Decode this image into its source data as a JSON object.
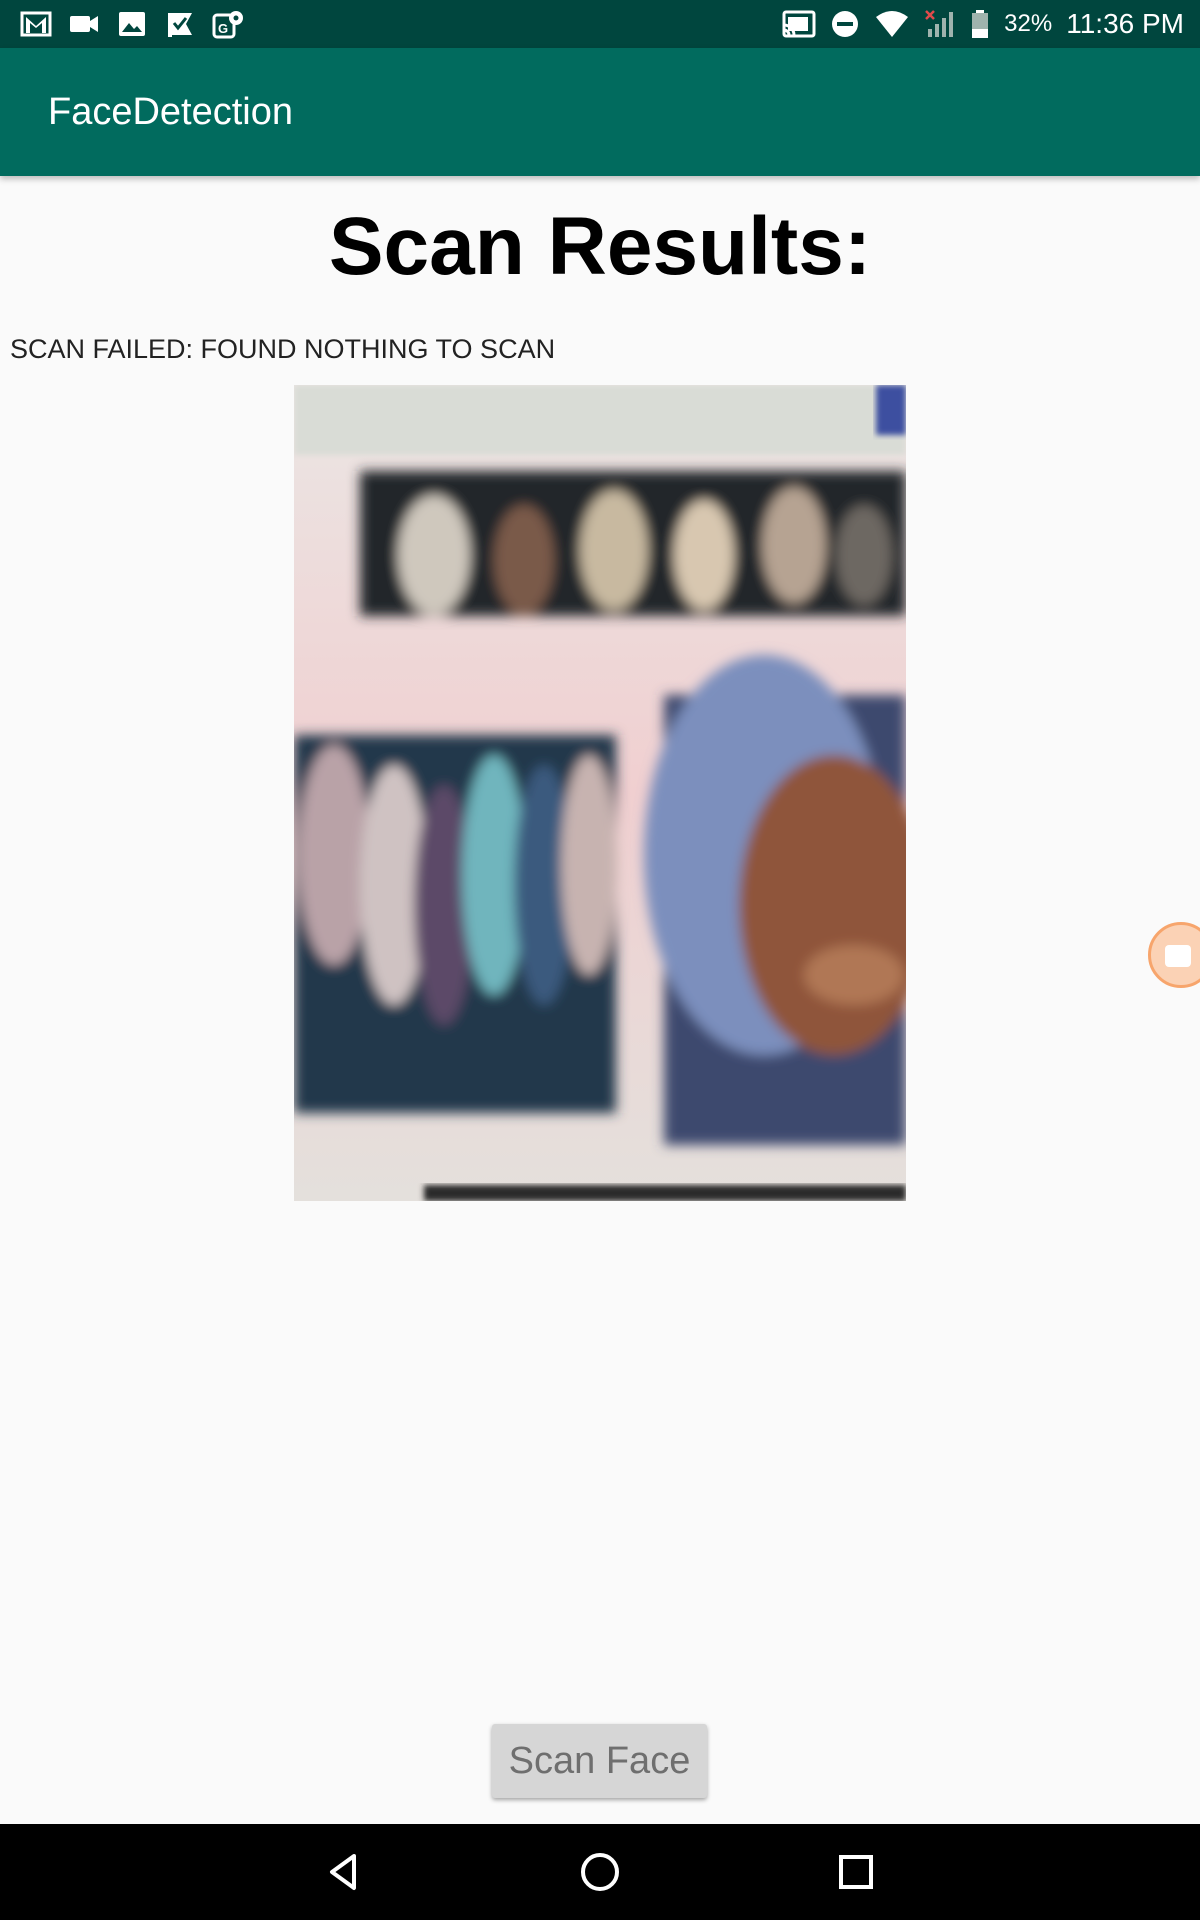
{
  "status_bar": {
    "left_icons": [
      "gmail-icon",
      "video-icon",
      "photo-icon",
      "check-flag-icon",
      "maps-icon"
    ],
    "right_icons": [
      "cast-icon",
      "do-not-disturb-icon",
      "wifi-icon",
      "no-signal-icon",
      "battery-icon"
    ],
    "battery_text": "32%",
    "clock": "11:36 PM",
    "colors": {
      "background": "#00463e",
      "foreground": "#ffffff"
    }
  },
  "app_bar": {
    "title": "FaceDetection",
    "color": "#016b5e"
  },
  "main": {
    "heading": "Scan Results:",
    "status_text": "SCAN FAILED: FOUND NOTHING TO SCAN",
    "photo_icon": "captured-photo",
    "floating_button_icon": "video-camera-icon"
  },
  "actions": {
    "scan_button_label": "Scan Face"
  },
  "nav_bar": {
    "buttons": [
      "back-icon",
      "home-icon",
      "recents-icon"
    ]
  }
}
